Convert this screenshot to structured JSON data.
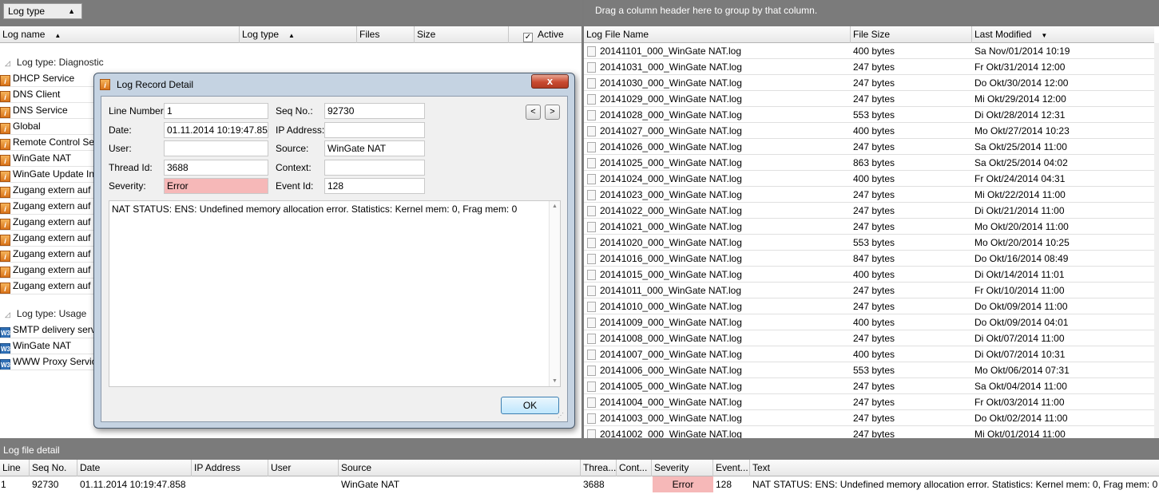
{
  "left_panel": {
    "group_chip": "Log type",
    "columns": {
      "log_name": "Log name",
      "log_type": "Log type",
      "files": "Files",
      "size": "Size",
      "active": "Active"
    },
    "active_checked": "✓",
    "groups": [
      {
        "label": "Log type: Diagnostic"
      },
      {
        "label": "Log type: Usage"
      }
    ],
    "diagnostic_rows": [
      "DHCP Service",
      "DNS Client",
      "DNS Service",
      "Global",
      "Remote Control Se",
      "WinGate NAT",
      "WinGate Update In",
      "Zugang extern auf",
      "Zugang extern auf",
      "Zugang extern auf",
      "Zugang extern auf",
      "Zugang extern auf",
      "Zugang extern auf",
      "Zugang extern auf"
    ],
    "usage_rows": [
      "SMTP delivery servi",
      "WinGate NAT",
      "WWW Proxy Servic"
    ]
  },
  "right_panel": {
    "group_hint": "Drag a column header here to group by that column.",
    "columns": {
      "name": "Log File Name",
      "size": "File Size",
      "modified": "Last Modified"
    },
    "rows": [
      [
        "20141101_000_WinGate NAT.log",
        "400 bytes",
        "Sa Nov/01/2014 10:19"
      ],
      [
        "20141031_000_WinGate NAT.log",
        "247 bytes",
        "Fr Okt/31/2014 12:00"
      ],
      [
        "20141030_000_WinGate NAT.log",
        "247 bytes",
        "Do Okt/30/2014 12:00"
      ],
      [
        "20141029_000_WinGate NAT.log",
        "247 bytes",
        "Mi Okt/29/2014 12:00"
      ],
      [
        "20141028_000_WinGate NAT.log",
        "553 bytes",
        "Di Okt/28/2014 12:31"
      ],
      [
        "20141027_000_WinGate NAT.log",
        "400 bytes",
        "Mo Okt/27/2014 10:23"
      ],
      [
        "20141026_000_WinGate NAT.log",
        "247 bytes",
        "Sa Okt/25/2014 11:00"
      ],
      [
        "20141025_000_WinGate NAT.log",
        "863 bytes",
        "Sa Okt/25/2014 04:02"
      ],
      [
        "20141024_000_WinGate NAT.log",
        "400 bytes",
        "Fr Okt/24/2014 04:31"
      ],
      [
        "20141023_000_WinGate NAT.log",
        "247 bytes",
        "Mi Okt/22/2014 11:00"
      ],
      [
        "20141022_000_WinGate NAT.log",
        "247 bytes",
        "Di Okt/21/2014 11:00"
      ],
      [
        "20141021_000_WinGate NAT.log",
        "247 bytes",
        "Mo Okt/20/2014 11:00"
      ],
      [
        "20141020_000_WinGate NAT.log",
        "553 bytes",
        "Mo Okt/20/2014 10:25"
      ],
      [
        "20141016_000_WinGate NAT.log",
        "847 bytes",
        "Do Okt/16/2014 08:49"
      ],
      [
        "20141015_000_WinGate NAT.log",
        "400 bytes",
        "Di Okt/14/2014 11:01"
      ],
      [
        "20141011_000_WinGate NAT.log",
        "247 bytes",
        "Fr Okt/10/2014 11:00"
      ],
      [
        "20141010_000_WinGate NAT.log",
        "247 bytes",
        "Do Okt/09/2014 11:00"
      ],
      [
        "20141009_000_WinGate NAT.log",
        "400 bytes",
        "Do Okt/09/2014 04:01"
      ],
      [
        "20141008_000_WinGate NAT.log",
        "247 bytes",
        "Di Okt/07/2014 11:00"
      ],
      [
        "20141007_000_WinGate NAT.log",
        "400 bytes",
        "Di Okt/07/2014 10:31"
      ],
      [
        "20141006_000_WinGate NAT.log",
        "553 bytes",
        "Mo Okt/06/2014 07:31"
      ],
      [
        "20141005_000_WinGate NAT.log",
        "247 bytes",
        "Sa Okt/04/2014 11:00"
      ],
      [
        "20141004_000_WinGate NAT.log",
        "247 bytes",
        "Fr Okt/03/2014 11:00"
      ],
      [
        "20141003_000_WinGate NAT.log",
        "247 bytes",
        "Do Okt/02/2014 11:00"
      ],
      [
        "20141002_000_WinGate NAT.log",
        "247 bytes",
        "Mi Okt/01/2014 11:00"
      ]
    ]
  },
  "bottom": {
    "title": "Log file detail",
    "columns": {
      "line": "Line",
      "seq": "Seq No.",
      "date": "Date",
      "ip": "IP Address",
      "user": "User",
      "source": "Source",
      "thread": "Threa...",
      "context": "Cont...",
      "severity": "Severity",
      "event": "Event...",
      "text": "Text"
    },
    "row": {
      "line": "1",
      "seq": "92730",
      "date": "01.11.2014 10:19:47.858",
      "ip": "",
      "user": "",
      "source": "WinGate NAT",
      "thread": "3688",
      "context": "",
      "severity": "Error",
      "event": "128",
      "text": "NAT STATUS: ENS: Undefined memory allocation error. Statistics: Kernel mem: 0, Frag mem: 0"
    }
  },
  "dialog": {
    "title": "Log Record Detail",
    "close_label": "x",
    "labels": {
      "line": "Line Number:",
      "date": "Date:",
      "user": "User:",
      "thread": "Thread Id:",
      "severity": "Severity:",
      "seq": "Seq No.:",
      "ip": "IP Address:",
      "source": "Source:",
      "context": "Context:",
      "event": "Event Id:"
    },
    "values": {
      "line": "1",
      "date": "01.11.2014 10:19:47.858",
      "user": "",
      "thread": "3688",
      "severity": "Error",
      "seq": "92730",
      "ip": "",
      "source": "WinGate NAT",
      "context": "",
      "event": "128"
    },
    "prev_label": "<",
    "next_label": ">",
    "message": "NAT STATUS: ENS: Undefined memory allocation error. Statistics: Kernel mem: 0, Frag mem: 0",
    "ok_label": "OK"
  },
  "colors": {
    "error_bg": "#f6b8b8",
    "band": "#7b7b7b"
  }
}
